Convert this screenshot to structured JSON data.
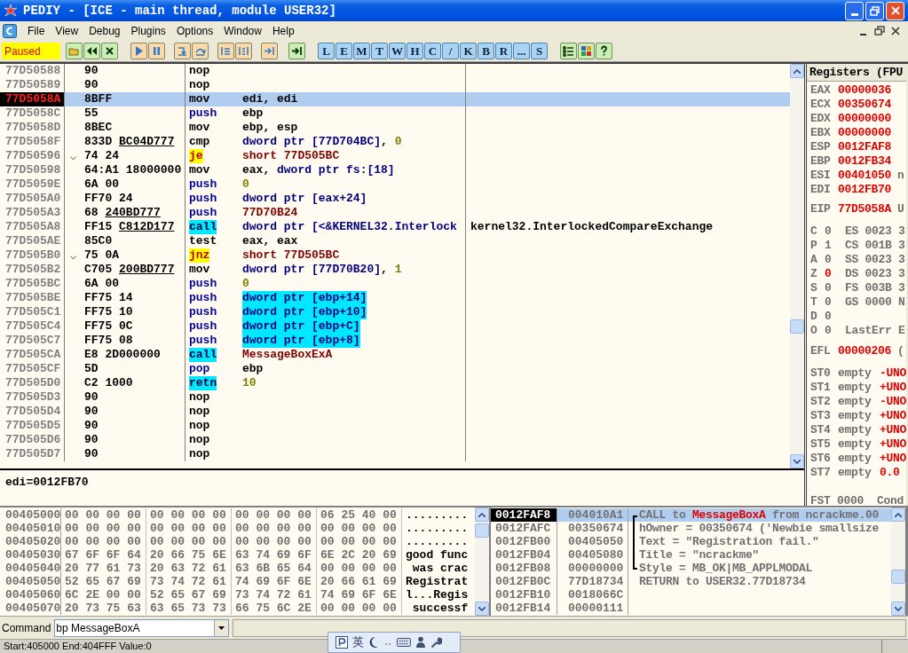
{
  "window": {
    "title": "PEDIY - [ICE - main thread, module USER32]"
  },
  "menu": [
    "File",
    "View",
    "Debug",
    "Plugins",
    "Options",
    "Window",
    "Help"
  ],
  "toolbar": {
    "status": "Paused",
    "letter_buttons": [
      "L",
      "E",
      "M",
      "T",
      "W",
      "H",
      "C",
      "/",
      "K",
      "B",
      "R",
      "...",
      "S"
    ]
  },
  "disassembly": {
    "rows": [
      {
        "address": {
          "text": "77D50588",
          "kind": "normal"
        },
        "hex": "90",
        "jump_marker": false,
        "mnemonic": {
          "text": "nop",
          "kind": "plain"
        },
        "selected": false
      },
      {
        "address": {
          "text": "77D50589",
          "kind": "normal"
        },
        "hex": "90",
        "jump_marker": false,
        "mnemonic": {
          "text": "nop",
          "kind": "plain"
        },
        "selected": false
      },
      {
        "address": {
          "text": "77D5058A",
          "kind": "current"
        },
        "hex": "8BFF",
        "jump_marker": false,
        "mnemonic": {
          "text": "mov",
          "kind": "plain"
        },
        "operands": [
          {
            "text": "edi, edi",
            "kind": "reg"
          }
        ],
        "highlight": false,
        "selected": true
      },
      {
        "address": {
          "text": "77D5058C",
          "kind": "normal"
        },
        "hex": "55",
        "jump_marker": false,
        "mnemonic": {
          "text": "push",
          "kind": "stack"
        },
        "operands": [
          {
            "text": "ebp",
            "kind": "reg"
          }
        ],
        "highlight": false,
        "selected": false
      },
      {
        "address": {
          "text": "77D5058D",
          "kind": "normal"
        },
        "hex": "8BEC",
        "jump_marker": false,
        "mnemonic": {
          "text": "mov",
          "kind": "plain"
        },
        "operands": [
          {
            "text": "ebp, esp",
            "kind": "reg"
          }
        ],
        "highlight": false,
        "selected": false
      },
      {
        "address": {
          "text": "77D5058F",
          "kind": "normal"
        },
        "hex": "833D",
        "fixup": "BC04D777",
        "jump_marker": false,
        "mnemonic": {
          "text": "cmp",
          "kind": "plain"
        },
        "operands": [
          {
            "text": "dword ptr [77D704BC]",
            "kind": "mem"
          },
          {
            "text": ", ",
            "kind": "reg"
          },
          {
            "text": "0",
            "kind": "const"
          }
        ],
        "highlight": false,
        "selected": false
      },
      {
        "address": {
          "text": "77D50596",
          "kind": "normal"
        },
        "hex": "74 24",
        "jump_marker": true,
        "mnemonic": {
          "text": "je",
          "kind": "jump"
        },
        "operands": [
          {
            "text": "short 77D505BC",
            "kind": "label"
          }
        ],
        "highlight": false,
        "selected": false
      },
      {
        "address": {
          "text": "77D50598",
          "kind": "normal"
        },
        "hex": "64:A1 18000000",
        "jump_marker": false,
        "mnemonic": {
          "text": "mov",
          "kind": "plain"
        },
        "operands": [
          {
            "text": "eax, ",
            "kind": "reg"
          },
          {
            "text": "dword ptr fs:[18]",
            "kind": "mem"
          }
        ],
        "highlight": false,
        "selected": false
      },
      {
        "address": {
          "text": "77D5059E",
          "kind": "normal"
        },
        "hex": "6A 00",
        "jump_marker": false,
        "mnemonic": {
          "text": "push",
          "kind": "stack"
        },
        "operands": [
          {
            "text": "0",
            "kind": "const"
          }
        ],
        "highlight": false,
        "selected": false
      },
      {
        "address": {
          "text": "77D505A0",
          "kind": "normal"
        },
        "hex": "FF70 24",
        "jump_marker": false,
        "mnemonic": {
          "text": "push",
          "kind": "stack"
        },
        "operands": [
          {
            "text": "dword ptr [eax+24]",
            "kind": "mem"
          }
        ],
        "highlight": false,
        "selected": false
      },
      {
        "address": {
          "text": "77D505A3",
          "kind": "normal"
        },
        "hex": "68",
        "fixup": "240BD777",
        "jump_marker": false,
        "mnemonic": {
          "text": "push",
          "kind": "stack"
        },
        "operands": [
          {
            "text": "77D70B24",
            "kind": "label"
          }
        ],
        "highlight": false,
        "selected": false
      },
      {
        "address": {
          "text": "77D505A8",
          "kind": "normal"
        },
        "hex": "FF15",
        "fixup": "C812D177",
        "jump_marker": false,
        "mnemonic": {
          "text": "call",
          "kind": "call"
        },
        "operands": [
          {
            "text": "dword ptr [<&KERNEL32.Interlock",
            "kind": "mem"
          }
        ],
        "highlight": false,
        "comment": "kernel32.InterlockedCompareExchange",
        "selected": false
      },
      {
        "address": {
          "text": "77D505AE",
          "kind": "normal"
        },
        "hex": "85C0",
        "jump_marker": false,
        "mnemonic": {
          "text": "test",
          "kind": "plain"
        },
        "operands": [
          {
            "text": "eax, eax",
            "kind": "reg"
          }
        ],
        "highlight": false,
        "selected": false
      },
      {
        "address": {
          "text": "77D505B0",
          "kind": "normal"
        },
        "hex": "75 0A",
        "jump_marker": true,
        "mnemonic": {
          "text": "jnz",
          "kind": "jump"
        },
        "operands": [
          {
            "text": "short 77D505BC",
            "kind": "label"
          }
        ],
        "highlight": false,
        "selected": false
      },
      {
        "address": {
          "text": "77D505B2",
          "kind": "normal"
        },
        "hex": "C705",
        "fixup": "200BD777",
        "jump_marker": false,
        "mnemonic": {
          "text": "mov",
          "kind": "plain"
        },
        "operands": [
          {
            "text": "dword ptr [77D70B20]",
            "kind": "mem"
          },
          {
            "text": ", ",
            "kind": "reg"
          },
          {
            "text": "1",
            "kind": "const"
          }
        ],
        "highlight": false,
        "selected": false
      },
      {
        "address": {
          "text": "77D505BC",
          "kind": "normal"
        },
        "hex": "6A 00",
        "jump_marker": false,
        "mnemonic": {
          "text": "push",
          "kind": "stack"
        },
        "operands": [
          {
            "text": "0",
            "kind": "const"
          }
        ],
        "highlight": false,
        "selected": false
      },
      {
        "address": {
          "text": "77D505BE",
          "kind": "normal"
        },
        "hex": "FF75 14",
        "jump_marker": false,
        "mnemonic": {
          "text": "push",
          "kind": "stack"
        },
        "operands": [
          {
            "text": "dword ptr [ebp+14]",
            "kind": "mem"
          }
        ],
        "highlight": true,
        "selected": false
      },
      {
        "address": {
          "text": "77D505C1",
          "kind": "normal"
        },
        "hex": "FF75 10",
        "jump_marker": false,
        "mnemonic": {
          "text": "push",
          "kind": "stack"
        },
        "operands": [
          {
            "text": "dword ptr [ebp+10]",
            "kind": "mem"
          }
        ],
        "highlight": true,
        "selected": false
      },
      {
        "address": {
          "text": "77D505C4",
          "kind": "normal"
        },
        "hex": "FF75 0C",
        "jump_marker": false,
        "mnemonic": {
          "text": "push",
          "kind": "stack"
        },
        "operands": [
          {
            "text": "dword ptr [ebp+C]",
            "kind": "mem"
          }
        ],
        "highlight": true,
        "selected": false
      },
      {
        "address": {
          "text": "77D505C7",
          "kind": "normal"
        },
        "hex": "FF75 08",
        "jump_marker": false,
        "mnemonic": {
          "text": "push",
          "kind": "stack"
        },
        "operands": [
          {
            "text": "dword ptr [ebp+8]",
            "kind": "mem"
          }
        ],
        "highlight": true,
        "selected": false
      },
      {
        "address": {
          "text": "77D505CA",
          "kind": "normal"
        },
        "hex": "E8 2D000000",
        "jump_marker": false,
        "mnemonic": {
          "text": "call",
          "kind": "call"
        },
        "operands": [
          {
            "text": "MessageBoxExA",
            "kind": "label"
          }
        ],
        "highlight": false,
        "selected": false
      },
      {
        "address": {
          "text": "77D505CF",
          "kind": "normal"
        },
        "hex": "5D",
        "jump_marker": false,
        "mnemonic": {
          "text": "pop",
          "kind": "stack"
        },
        "operands": [
          {
            "text": "ebp",
            "kind": "reg"
          }
        ],
        "highlight": false,
        "selected": false
      },
      {
        "address": {
          "text": "77D505D0",
          "kind": "normal"
        },
        "hex": "C2 1000",
        "jump_marker": false,
        "mnemonic": {
          "text": "retn",
          "kind": "call"
        },
        "operands": [
          {
            "text": "10",
            "kind": "const"
          }
        ],
        "highlight": false,
        "selected": false
      },
      {
        "address": {
          "text": "77D505D3",
          "kind": "normal"
        },
        "hex": "90",
        "jump_marker": false,
        "mnemonic": {
          "text": "nop",
          "kind": "plain"
        },
        "selected": false
      },
      {
        "address": {
          "text": "77D505D4",
          "kind": "normal"
        },
        "hex": "90",
        "jump_marker": false,
        "mnemonic": {
          "text": "nop",
          "kind": "plain"
        },
        "selected": false
      },
      {
        "address": {
          "text": "77D505D5",
          "kind": "normal"
        },
        "hex": "90",
        "jump_marker": false,
        "mnemonic": {
          "text": "nop",
          "kind": "plain"
        },
        "selected": false
      },
      {
        "address": {
          "text": "77D505D6",
          "kind": "normal"
        },
        "hex": "90",
        "jump_marker": false,
        "mnemonic": {
          "text": "nop",
          "kind": "plain"
        },
        "selected": false
      },
      {
        "address": {
          "text": "77D505D7",
          "kind": "normal"
        },
        "hex": "90",
        "jump_marker": false,
        "mnemonic": {
          "text": "nop",
          "kind": "plain"
        },
        "selected": false
      }
    ],
    "info": "edi=0012FB70"
  },
  "registers": {
    "title": "Registers (FPU",
    "general": [
      {
        "name": "EAX",
        "value": "00000036",
        "changed": true
      },
      {
        "name": "ECX",
        "value": "00350674",
        "changed": true
      },
      {
        "name": "EDX",
        "value": "00000000",
        "changed": true
      },
      {
        "name": "EBX",
        "value": "00000000",
        "changed": true
      },
      {
        "name": "ESP",
        "value": "0012FAF8",
        "changed": true
      },
      {
        "name": "EBP",
        "value": "0012FB34",
        "changed": true
      },
      {
        "name": "ESI",
        "value": "00401050",
        "tail": "n",
        "changed": true
      },
      {
        "name": "EDI",
        "value": "0012FB70",
        "changed": true
      }
    ],
    "eip": {
      "name": "EIP",
      "value": "77D5058A",
      "tail": "U",
      "changed": true
    },
    "flags": [
      {
        "flag": "C",
        "value": "0",
        "changed": false,
        "rest": "ES 0023 3"
      },
      {
        "flag": "P",
        "value": "1",
        "changed": false,
        "rest": "CS 001B 3"
      },
      {
        "flag": "A",
        "value": "0",
        "changed": false,
        "rest": "SS 0023 3"
      },
      {
        "flag": "Z",
        "value": "0",
        "changed": true,
        "rest": "DS 0023 3"
      },
      {
        "flag": "S",
        "value": "0",
        "changed": false,
        "rest": "FS 003B 3"
      },
      {
        "flag": "T",
        "value": "0",
        "changed": false,
        "rest": "GS 0000 N"
      },
      {
        "flag": "D",
        "value": "0",
        "changed": false
      },
      {
        "flag": "O",
        "value": "0",
        "changed": false,
        "rest": "LastErr E"
      }
    ],
    "efl": {
      "name": "EFL",
      "value": "00000206",
      "tail": "(",
      "changed": true
    },
    "fpu": [
      {
        "name": "ST0",
        "tag": "empty",
        "value": "-UNO",
        "changed": true
      },
      {
        "name": "ST1",
        "tag": "empty",
        "value": "+UNO",
        "changed": true
      },
      {
        "name": "ST2",
        "tag": "empty",
        "value": "-UNO",
        "changed": true
      },
      {
        "name": "ST3",
        "tag": "empty",
        "value": "+UNO",
        "changed": true
      },
      {
        "name": "ST4",
        "tag": "empty",
        "value": "+UNO",
        "changed": true
      },
      {
        "name": "ST5",
        "tag": "empty",
        "value": "+UNO",
        "changed": true
      },
      {
        "name": "ST6",
        "tag": "empty",
        "value": "+UNO",
        "changed": true
      },
      {
        "name": "ST7",
        "tag": "empty",
        "value": "0.0",
        "changed": true
      }
    ],
    "fst": "FST 0000  Cond"
  },
  "dump": {
    "rows": [
      {
        "address": "00405000",
        "bytes": [
          "00 00 00 00",
          "00 00 00 00",
          "00 00 00 00",
          "06 25 40 00"
        ],
        "ascii": "........."
      },
      {
        "address": "00405010",
        "bytes": [
          "00 00 00 00",
          "00 00 00 00",
          "00 00 00 00",
          "00 00 00 00"
        ],
        "ascii": "........."
      },
      {
        "address": "00405020",
        "bytes": [
          "00 00 00 00",
          "00 00 00 00",
          "00 00 00 00",
          "00 00 00 00"
        ],
        "ascii": "........."
      },
      {
        "address": "00405030",
        "bytes": [
          "67 6F 6F 64",
          "20 66 75 6E",
          "63 74 69 6F",
          "6E 2C 20 69"
        ],
        "ascii": "good func"
      },
      {
        "address": "00405040",
        "bytes": [
          "20 77 61 73",
          "20 63 72 61",
          "63 6B 65 64",
          "00 00 00 00"
        ],
        "ascii": " was crac"
      },
      {
        "address": "00405050",
        "bytes": [
          "52 65 67 69",
          "73 74 72 61",
          "74 69 6F 6E",
          "20 66 61 69"
        ],
        "ascii": "Registrat"
      },
      {
        "address": "00405060",
        "bytes": [
          "6C 2E 00 00",
          "52 65 67 69",
          "73 74 72 61",
          "74 69 6F 6E"
        ],
        "ascii": "l...Regis"
      },
      {
        "address": "00405070",
        "bytes": [
          "20 73 75 63",
          "63 65 73 73",
          "66 75 6C 2E",
          "00 00 00 00"
        ],
        "ascii": " successf"
      }
    ]
  },
  "stack": {
    "rows": [
      {
        "address": "0012FAF8",
        "value": "004010A1",
        "kind": "top",
        "comment": [
          {
            "text": "CALL to ",
            "kind": "plain"
          },
          {
            "text": "MessageBoxA",
            "kind": "symbol"
          },
          {
            "text": " from ncrackme.00",
            "kind": "plain"
          }
        ],
        "selected": true
      },
      {
        "address": "0012FAFC",
        "value": "00350674",
        "kind": "middle",
        "comment": [
          {
            "text": "hOwner = 00350674 ('Newbie smallsize",
            "kind": "plain"
          }
        ],
        "selected": false
      },
      {
        "address": "0012FB00",
        "value": "00405050",
        "kind": "middle",
        "comment": [
          {
            "text": "Text = \"Registration fail.\"",
            "kind": "plain"
          }
        ],
        "selected": false
      },
      {
        "address": "0012FB04",
        "value": "00405080",
        "kind": "middle",
        "comment": [
          {
            "text": "Title = \"ncrackme\"",
            "kind": "plain"
          }
        ],
        "selected": false
      },
      {
        "address": "0012FB08",
        "value": "00000000",
        "kind": "bottom",
        "comment": [
          {
            "text": "Style = MB_OK|MB_APPLMODAL",
            "kind": "plain"
          }
        ],
        "selected": false
      },
      {
        "address": "0012FB0C",
        "value": "77D18734",
        "kind": "none",
        "comment": [
          {
            "text": "RETURN to USER32.77D18734",
            "kind": "plain"
          }
        ],
        "selected": false
      },
      {
        "address": "0012FB10",
        "value": "0018066C",
        "kind": "none",
        "selected": false
      },
      {
        "address": "0012FB14",
        "value": "00000111",
        "kind": "none",
        "selected": false
      }
    ]
  },
  "command": {
    "label": "Command",
    "value": "bp MessageBoxA"
  },
  "status_bar": "Start:405000 End:404FFF Value:0",
  "ime": {
    "language": "英"
  }
}
